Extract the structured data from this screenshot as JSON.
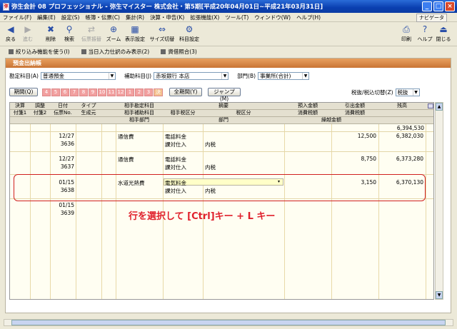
{
  "window": {
    "title": "弥生会計 08 プロフェッショナル - 弥生マイスター 株式会社・第5期[平成20年04月01日~平成21年03月31日]"
  },
  "menu": [
    "ファイル(F)",
    "編集(E)",
    "設定(S)",
    "帳簿・伝票(C)",
    "集計(R)",
    "決算・申告(K)",
    "拡張機能(X)",
    "ツール(T)",
    "ウィンドウ(W)",
    "ヘルプ(H)"
  ],
  "navi": "ナビゲータ",
  "toolbar": {
    "back": "戻る",
    "forward": "進む",
    "delete": "削除",
    "search": "検索",
    "transfer": "伝票振替",
    "zoom": "ズーム",
    "display": "表示設定",
    "size": "サイズ切替",
    "account": "科目設定",
    "print": "印刷",
    "help": "ヘルプ",
    "close": "閉じる"
  },
  "quick": [
    "絞り込み機能を使う(I)",
    "当日入力仕訳のみ表示(2)",
    "資借照合(3)"
  ],
  "panel_title": "預金出納帳",
  "filters": {
    "account_label": "勘定科目(A)",
    "account_value": "普通預金",
    "sub_label": "補助科目(J)",
    "sub_value": "赤坂銀行 本店",
    "dept_label": "部門(B)",
    "dept_value": "事業所(合計)"
  },
  "period": {
    "label": "期間(Q)",
    "months": [
      "4",
      "5",
      "6",
      "7",
      "8",
      "9",
      "10",
      "11",
      "12",
      "1",
      "2",
      "3",
      "決"
    ],
    "all": "全期間(Y)",
    "jump": "ジャンプ(M)",
    "tax_label": "税抜/税込切替(Z)",
    "tax_value": "税抜"
  },
  "headers": {
    "row1": [
      "決算",
      "調整",
      "日付",
      "タイプ",
      "相手勘定科目",
      "摘要",
      "預入金額",
      "引出金額",
      "残高"
    ],
    "row2": [
      "付箋1",
      "付箋2",
      "伝票No.",
      "生成元",
      "相手補助科目",
      "相手税区分",
      "税区分",
      "消費税額",
      "消費税額"
    ],
    "row3": [
      "相手部門",
      "部門",
      "繰越金額"
    ]
  },
  "carry": "6,394,530",
  "rows": [
    {
      "date": "12/27",
      "no": "3636",
      "account": "通信費",
      "memo": "電話料金",
      "tax": "課対仕入",
      "taxtype": "内税",
      "deposit": "12,500",
      "withdraw": "",
      "balance": "6,382,030"
    },
    {
      "date": "12/27",
      "no": "3637",
      "account": "通信費",
      "memo": "電話料金",
      "tax": "課対仕入",
      "taxtype": "内税",
      "deposit": "8,750",
      "withdraw": "",
      "balance": "6,373,280"
    },
    {
      "date": "01/15",
      "no": "3638",
      "account": "水道光熱費",
      "memo": "電気料金",
      "tax": "課対仕入",
      "taxtype": "内税",
      "deposit": "3,150",
      "withdraw": "",
      "balance": "6,370,130"
    },
    {
      "date": "01/15",
      "no": "3639",
      "account": "",
      "memo": "",
      "tax": "",
      "taxtype": "",
      "deposit": "",
      "withdraw": "",
      "balance": ""
    }
  ],
  "annotation": "行を選択して [Ctrl]キー + L キー"
}
